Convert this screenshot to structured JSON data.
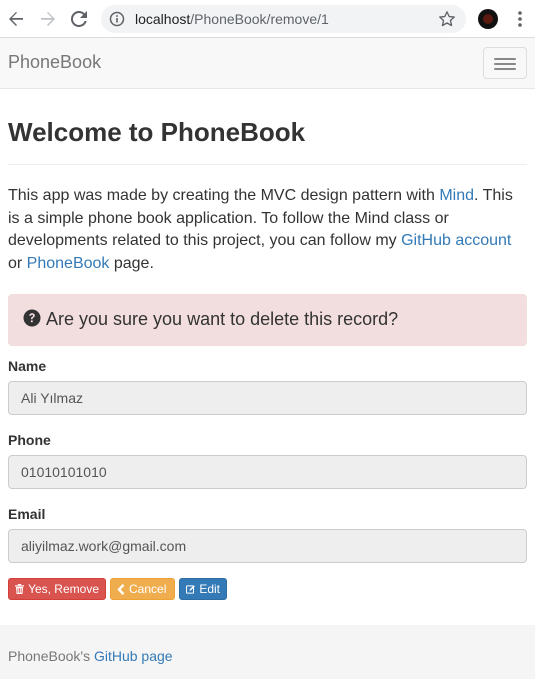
{
  "browser": {
    "url_host": "localhost",
    "url_path": "/PhoneBook/remove/1"
  },
  "navbar": {
    "brand": "PhoneBook"
  },
  "page": {
    "title": "Welcome to PhoneBook",
    "intro_1": "This app was made by creating the MVC design pattern with ",
    "link_mind": "Mind",
    "intro_2": ". This is a simple phone book application. To follow the Mind class or developments related to this project, you can follow my ",
    "link_github": "GitHub account",
    "intro_3": " or ",
    "link_phonebook": "PhoneBook",
    "intro_4": " page."
  },
  "alert": {
    "message": "Are you sure you want to delete this record?"
  },
  "form": {
    "name_label": "Name",
    "name_value": "Ali Yılmaz",
    "phone_label": "Phone",
    "phone_value": "01010101010",
    "email_label": "Email",
    "email_value": "aliyilmaz.work@gmail.com"
  },
  "actions": {
    "remove_label": "Yes, Remove",
    "cancel_label": "Cancel",
    "edit_label": "Edit"
  },
  "footer": {
    "prefix": "PhoneBook's ",
    "link": "GitHub page"
  },
  "colors": {
    "link": "#337ab7",
    "danger": "#d9534f",
    "warning": "#f0ad4e",
    "primary": "#337ab7",
    "alert_bg": "#f2dede"
  }
}
